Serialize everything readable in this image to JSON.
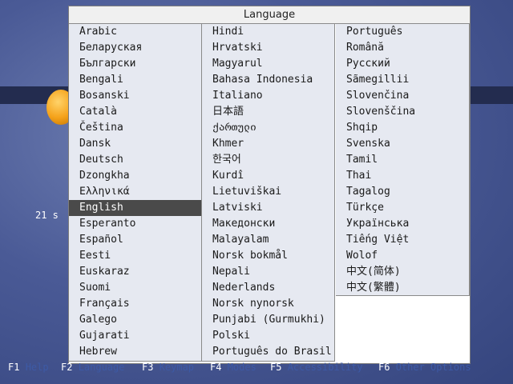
{
  "timer": "21 s",
  "dialog": {
    "title": "Language",
    "selected": "English",
    "columns": [
      [
        "Arabic",
        "Беларуская",
        "Български",
        "Bengali",
        "Bosanski",
        "Català",
        "Čeština",
        "Dansk",
        "Deutsch",
        "Dzongkha",
        "Ελληνικά",
        "English",
        "Esperanto",
        "Español",
        "Eesti",
        "Euskaraz",
        "Suomi",
        "Français",
        "Galego",
        "Gujarati",
        "Hebrew"
      ],
      [
        "Hindi",
        "Hrvatski",
        "Magyarul",
        "Bahasa Indonesia",
        "Italiano",
        "日本語",
        "ქართული",
        "Khmer",
        "한국어",
        "Kurdî",
        "Lietuviškai",
        "Latviski",
        "Македонски",
        "Malayalam",
        "Norsk bokmål",
        "Nepali",
        "Nederlands",
        "Norsk nynorsk",
        "Punjabi (Gurmukhi)",
        "Polski",
        "Português do Brasil"
      ],
      [
        "Português",
        "Română",
        "Русский",
        "Sãmegillii",
        "Slovenčina",
        "Slovenščina",
        "Shqip",
        "Svenska",
        "Tamil",
        "Thai",
        "Tagalog",
        "Türkçe",
        "Українська",
        "Tiếng Việt",
        "Wolof",
        "中文(简体)",
        "中文(繁體)"
      ]
    ]
  },
  "fkeys": [
    {
      "key": "F1",
      "label": "Help"
    },
    {
      "key": "F2",
      "label": "Language"
    },
    {
      "key": "F3",
      "label": "Keymap"
    },
    {
      "key": "F4",
      "label": "Modes"
    },
    {
      "key": "F5",
      "label": "Accessibility"
    },
    {
      "key": "F6",
      "label": "Other Options"
    }
  ]
}
